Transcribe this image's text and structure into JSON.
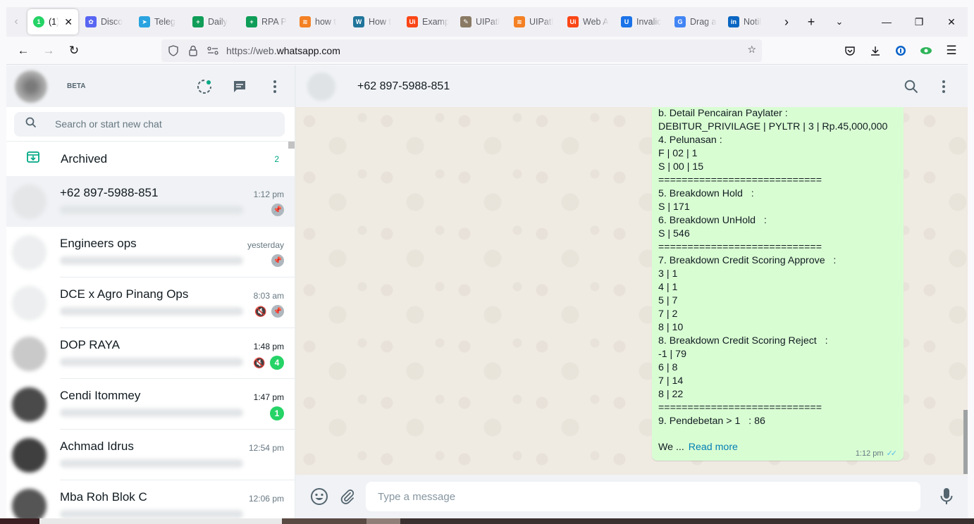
{
  "browser": {
    "tabs": [
      {
        "label": "(1)",
        "favicon_color": "#25d366",
        "favicon_glyph": "1",
        "active": true
      },
      {
        "label": "Disco",
        "favicon_color": "#5865f2",
        "favicon_glyph": "✿"
      },
      {
        "label": "Teleg",
        "favicon_color": "#2aa3e0",
        "favicon_glyph": "➤"
      },
      {
        "label": "Daily",
        "favicon_color": "#0f9d58",
        "favicon_glyph": "+"
      },
      {
        "label": "RPA P",
        "favicon_color": "#0f9d58",
        "favicon_glyph": "+"
      },
      {
        "label": "how t",
        "favicon_color": "#f48024",
        "favicon_glyph": "≋"
      },
      {
        "label": "How t",
        "favicon_color": "#21759b",
        "favicon_glyph": "W"
      },
      {
        "label": "Examp",
        "favicon_color": "#fa4616",
        "favicon_glyph": "Ui"
      },
      {
        "label": "UIPatl",
        "favicon_color": "#8a7a64",
        "favicon_glyph": "✎"
      },
      {
        "label": "UIPatl",
        "favicon_color": "#f48024",
        "favicon_glyph": "≋"
      },
      {
        "label": "Web A",
        "favicon_color": "#fa4616",
        "favicon_glyph": "Ui"
      },
      {
        "label": "Invalic",
        "favicon_color": "#1a73e8",
        "favicon_glyph": "U"
      },
      {
        "label": "Drag a",
        "favicon_color": "#4285f4",
        "favicon_glyph": "G"
      },
      {
        "label": "Notil",
        "favicon_color": "#0a66c2",
        "favicon_glyph": "in"
      }
    ],
    "url_scheme": "https://web.",
    "url_host": "whatsapp.com",
    "url_rest": ""
  },
  "left": {
    "beta_label": "BETA",
    "search_placeholder": "Search or start new chat",
    "archived_label": "Archived",
    "archived_count": "2",
    "chats": [
      {
        "name": "+62 897-5988-851",
        "time": "1:12 pm",
        "pinned": true,
        "muted": false,
        "badge": "",
        "avatar_color": "#e4e6e8",
        "selected": true
      },
      {
        "name": "Engineers ops",
        "time": "yesterday",
        "pinned": true,
        "muted": false,
        "badge": "",
        "avatar_color": "#eceeef"
      },
      {
        "name": "DCE x Agro Pinang Ops",
        "time": "8:03 am",
        "pinned": true,
        "muted": true,
        "badge": "",
        "avatar_color": "#eceeef"
      },
      {
        "name": "DOP RAYA",
        "time": "1:48 pm",
        "pinned": false,
        "muted": true,
        "badge": "4",
        "avatar_color": "#c9c9c9"
      },
      {
        "name": "Cendi Itommey",
        "time": "1:47 pm",
        "pinned": false,
        "muted": false,
        "badge": "1",
        "avatar_color": "#4a4a4a"
      },
      {
        "name": "Achmad Idrus",
        "time": "12:54 pm",
        "pinned": false,
        "muted": false,
        "badge": "",
        "avatar_color": "#3f3f3f"
      },
      {
        "name": "Mba Roh Blok C",
        "time": "12:06 pm",
        "pinned": false,
        "muted": false,
        "badge": "",
        "avatar_color": "#555555"
      }
    ]
  },
  "conversation": {
    "contact_name": "+62 897-5988-851",
    "message_lines": [
      "b. Detail Pencairan Paylater :",
      "DEBITUR_PRIVILAGE | PYLTR | 3 | Rp.45,000,000",
      "4. Pelunasan :",
      "F | 02 | 1",
      "S | 00 | 15",
      "============================",
      "5. Breakdown Hold   :",
      "S | 171",
      "6. Breakdown UnHold   :",
      "S | 546",
      "============================",
      "7. Breakdown Credit Scoring Approve   :",
      "3 | 1",
      "4 | 1",
      "5 | 7",
      "7 | 2",
      "8 | 10",
      "8. Breakdown Credit Scoring Reject   :",
      "-1 | 79",
      "6 | 8",
      "7 | 14",
      "8 | 22",
      "============================",
      "9. Pendebetan > 1   : 86"
    ],
    "message_tail": "We ...",
    "read_more": "Read more",
    "message_time": "1:12 pm",
    "input_placeholder": "Type a message"
  },
  "colors": {
    "accent": "#00a884",
    "bubble_out": "#d9fdd3",
    "unread_badge": "#25d366",
    "link": "#027eb5"
  }
}
